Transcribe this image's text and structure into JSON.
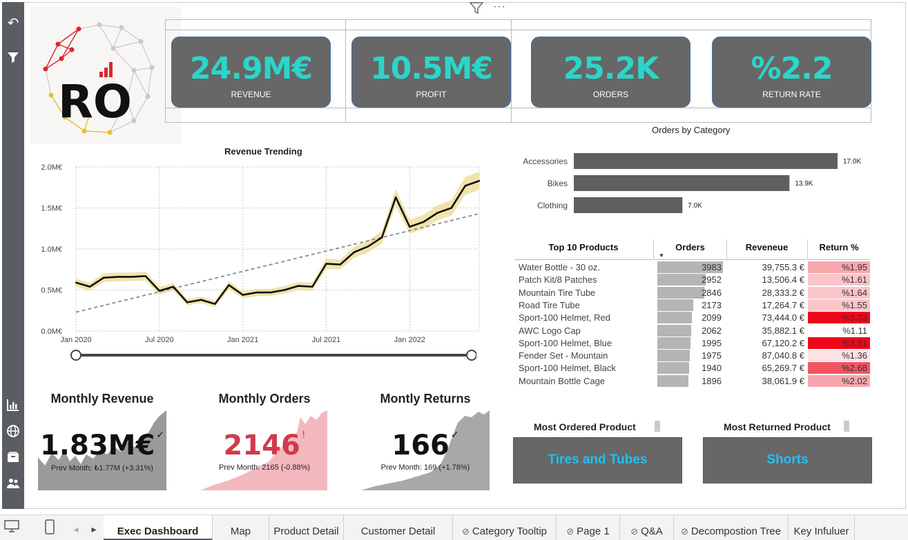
{
  "kpis": [
    {
      "value": "24.9M€",
      "label": "REVENUE"
    },
    {
      "value": "10.5M€",
      "label": "PROFIT"
    },
    {
      "value": "25.2K",
      "label": "ORDERS"
    },
    {
      "value": "%2.2",
      "label": "RETURN RATE"
    }
  ],
  "logo": {
    "text": "RO"
  },
  "colors": {
    "accent": "#2ad6c9",
    "card": "#676767",
    "bar": "#5f5f5f",
    "highlight": "#1ec1f5",
    "negative": "#d13a4a"
  },
  "revenue_chart": {
    "title": "Revenue Trending",
    "y_ticks": [
      "2.0M€",
      "1.5M€",
      "1.0M€",
      "0.5M€",
      "0.0M€"
    ],
    "x_ticks": [
      "Jan 2020",
      "Jul 2020",
      "Jan 2021",
      "Jul 2021",
      "Jan 2022"
    ]
  },
  "category_chart": {
    "title": "Orders by Category"
  },
  "top_products": {
    "headers": {
      "product": "Top 10 Products",
      "orders": "Orders",
      "revenue": "Reveneue",
      "return": "Return %"
    }
  },
  "monthly": [
    {
      "title": "Monthly Revenue",
      "value": "1.83M€",
      "indicator": "✓",
      "prev": "Prev Month: ₺1.77M (+3.31%)"
    },
    {
      "title": "Monthly Orders",
      "value": "2146",
      "indicator": "!",
      "prev": "Prev Month: 2165 (-0.88%)"
    },
    {
      "title": "Montly Returns",
      "value": "166",
      "indicator": "✓",
      "prev": "Prev Month: 169 (+1.78%)"
    }
  ],
  "most": {
    "ordered_title": "Most Ordered Product",
    "ordered_value": "Tires and Tubes",
    "returned_title": "Most Returned Product",
    "returned_value": "Shorts"
  },
  "tabs": [
    {
      "label": "Exec Dashboard",
      "hidden": false,
      "active": true
    },
    {
      "label": "Map",
      "hidden": false
    },
    {
      "label": "Product Detail",
      "hidden": false
    },
    {
      "label": "Customer Detail",
      "hidden": false
    },
    {
      "label": "Category Tooltip",
      "hidden": true
    },
    {
      "label": "Page 1",
      "hidden": true
    },
    {
      "label": "Q&A",
      "hidden": true
    },
    {
      "label": "Decompostion Tree",
      "hidden": true
    },
    {
      "label": "Key Infuluer",
      "hidden": false
    }
  ],
  "chart_data": [
    {
      "type": "line",
      "title": "Revenue Trending",
      "x": [
        "2020-01",
        "2020-02",
        "2020-03",
        "2020-04",
        "2020-05",
        "2020-06",
        "2020-07",
        "2020-08",
        "2020-09",
        "2020-10",
        "2020-11",
        "2020-12",
        "2021-01",
        "2021-02",
        "2021-03",
        "2021-04",
        "2021-05",
        "2021-06",
        "2021-07",
        "2021-08",
        "2021-09",
        "2021-10",
        "2021-11",
        "2021-12",
        "2022-01",
        "2022-02",
        "2022-03",
        "2022-04",
        "2022-05",
        "2022-06"
      ],
      "series": [
        {
          "values": [
            0.59,
            0.54,
            0.65,
            0.66,
            0.66,
            0.67,
            0.49,
            0.54,
            0.35,
            0.38,
            0.33,
            0.56,
            0.44,
            0.47,
            0.47,
            0.5,
            0.55,
            0.54,
            0.82,
            0.81,
            0.96,
            1.03,
            1.14,
            1.63,
            1.27,
            1.33,
            1.44,
            1.5,
            1.77,
            1.83
          ]
        },
        {
          "values": [
            0.23,
            1.43
          ]
        }
      ],
      "ylim": [
        0,
        2.0
      ],
      "y_unit": "M€",
      "grid": true
    },
    {
      "type": "bar",
      "title": "Orders by Category",
      "categories": [
        "Accessories",
        "Bikes",
        "Clothing"
      ],
      "values": [
        17.0,
        13.9,
        7.0
      ],
      "labels": [
        "17.0K",
        "13.9K",
        "7.0K"
      ]
    },
    {
      "type": "table",
      "title": "Top 10 Products",
      "columns": [
        "Top 10 Products",
        "Orders",
        "Reveneue",
        "Return %"
      ],
      "rows": [
        [
          "Water Bottle - 30 oz.",
          3983,
          "39,755.3 €",
          "%1.95",
          1.95
        ],
        [
          "Patch Kit/8 Patches",
          2952,
          "13,506.4 €",
          "%1.61",
          1.61
        ],
        [
          "Mountain Tire Tube",
          2846,
          "28,333.2 €",
          "%1.64",
          1.64
        ],
        [
          "Road Tire Tube",
          2173,
          "17,264.7 €",
          "%1.55",
          1.55
        ],
        [
          "Sport-100 Helmet, Red",
          2099,
          "73,444.0 €",
          "%3.33",
          3.33
        ],
        [
          "AWC Logo Cap",
          2062,
          "35,882.1 €",
          "%1.11",
          1.11
        ],
        [
          "Sport-100 Helmet, Blue",
          1995,
          "67,120.2 €",
          "%3.31",
          3.31
        ],
        [
          "Fender Set - Mountain",
          1975,
          "87,040.8 €",
          "%1.36",
          1.36
        ],
        [
          "Sport-100 Helmet, Black",
          1940,
          "65,269.7 €",
          "%2.68",
          2.68
        ],
        [
          "Mountain Bottle Cage",
          1896,
          "38,061.9 €",
          "%2.02",
          2.02
        ]
      ]
    }
  ]
}
